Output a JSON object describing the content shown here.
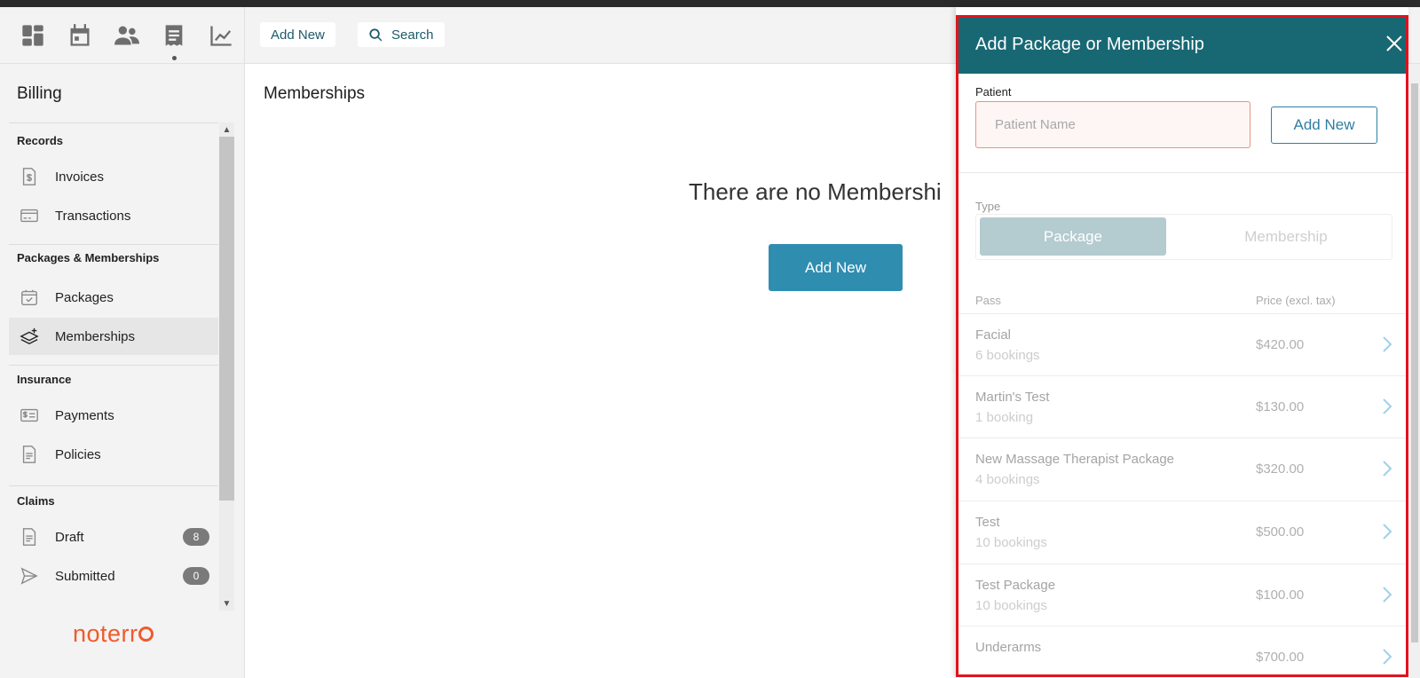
{
  "topbar": {
    "nav_icons": [
      "dashboard-icon",
      "calendar-icon",
      "people-icon",
      "receipt-icon",
      "chart-icon"
    ],
    "add_new_label": "Add New",
    "search_label": "Search"
  },
  "sidebar": {
    "title": "Billing",
    "sections": {
      "records": "Records",
      "packages": "Packages & Memberships",
      "insurance": "Insurance",
      "claims": "Claims"
    },
    "items": {
      "invoices": "Invoices",
      "transactions": "Transactions",
      "packages": "Packages",
      "memberships": "Memberships",
      "payments": "Payments",
      "policies": "Policies",
      "draft": "Draft",
      "submitted": "Submitted"
    },
    "badges": {
      "draft": "8",
      "submitted": "0"
    },
    "logo": "noterr"
  },
  "main": {
    "title": "Memberships",
    "empty_message": "There are no Membershi",
    "add_new_label": "Add New"
  },
  "panel": {
    "title": "Add Package or Membership",
    "patient_label": "Patient",
    "patient_placeholder": "Patient Name",
    "add_new_label": "Add New",
    "type_label": "Type",
    "type_options": {
      "package": "Package",
      "membership": "Membership"
    },
    "selected_type": "Package",
    "col_pass": "Pass",
    "col_price": "Price (excl. tax)",
    "passes": [
      {
        "name": "Facial",
        "bookings": "6 bookings",
        "price": "$420.00"
      },
      {
        "name": "Martin's Test",
        "bookings": "1 booking",
        "price": "$130.00"
      },
      {
        "name": "New Massage Therapist Package",
        "bookings": "4 bookings",
        "price": "$320.00"
      },
      {
        "name": "Test",
        "bookings": "10 bookings",
        "price": "$500.00"
      },
      {
        "name": "Test Package",
        "bookings": "10 bookings",
        "price": "$100.00"
      },
      {
        "name": "Underarms",
        "bookings": "",
        "price": "$700.00"
      }
    ]
  },
  "colors": {
    "panel_header": "#186874",
    "primary_button": "#2f8db0",
    "logo": "#f15a2b",
    "highlight_frame": "#e3121b"
  }
}
